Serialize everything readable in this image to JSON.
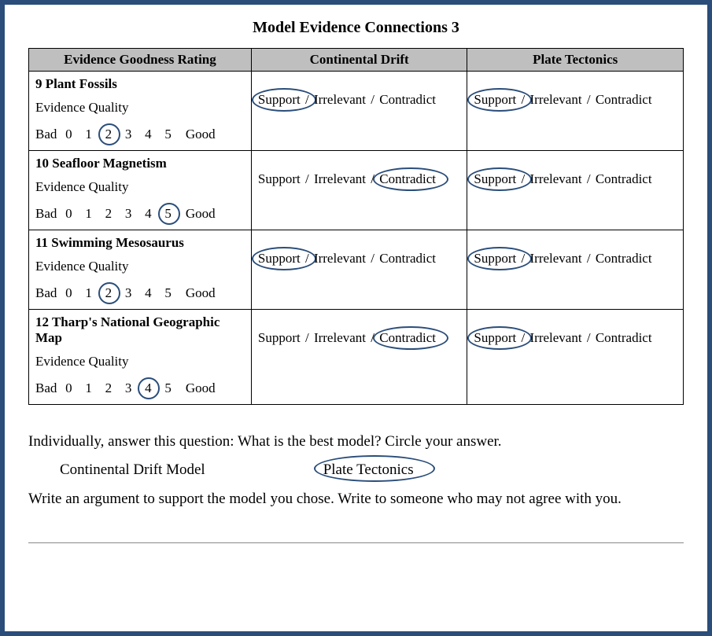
{
  "title": "Model Evidence Connections 3",
  "headers": {
    "left": "Evidence Goodness Rating",
    "mid": "Continental Drift",
    "right": "Plate Tectonics"
  },
  "labels": {
    "evidence_quality": "Evidence Quality",
    "bad": "Bad",
    "good": "Good",
    "support": "Support",
    "irrelevant": "Irrelevant",
    "contradict": "Contradict"
  },
  "scale": [
    "0",
    "1",
    "2",
    "3",
    "4",
    "5"
  ],
  "rows": [
    {
      "title": "9 Plant Fossils",
      "circled_rating": "2",
      "drift_circled": "Support",
      "tectonics_circled": "Support"
    },
    {
      "title": "10 Seafloor Magnetism",
      "circled_rating": "5",
      "drift_circled": "Contradict",
      "tectonics_circled": "Support"
    },
    {
      "title": "11 Swimming Mesosaurus",
      "circled_rating": "2",
      "drift_circled": "Support",
      "tectonics_circled": "Support"
    },
    {
      "title": "12 Tharp's National Geographic Map",
      "circled_rating": "4",
      "drift_circled": "Contradict",
      "tectonics_circled": "Support"
    }
  ],
  "question": {
    "prompt": "Individually, answer this question:  What is the best model? Circle your answer.",
    "choice_a": "Continental Drift Model",
    "choice_b": "Plate Tectonics",
    "circled_choice": "Plate Tectonics",
    "argument_prompt": "Write an argument to support the model you chose.  Write to someone who may not agree with you."
  }
}
